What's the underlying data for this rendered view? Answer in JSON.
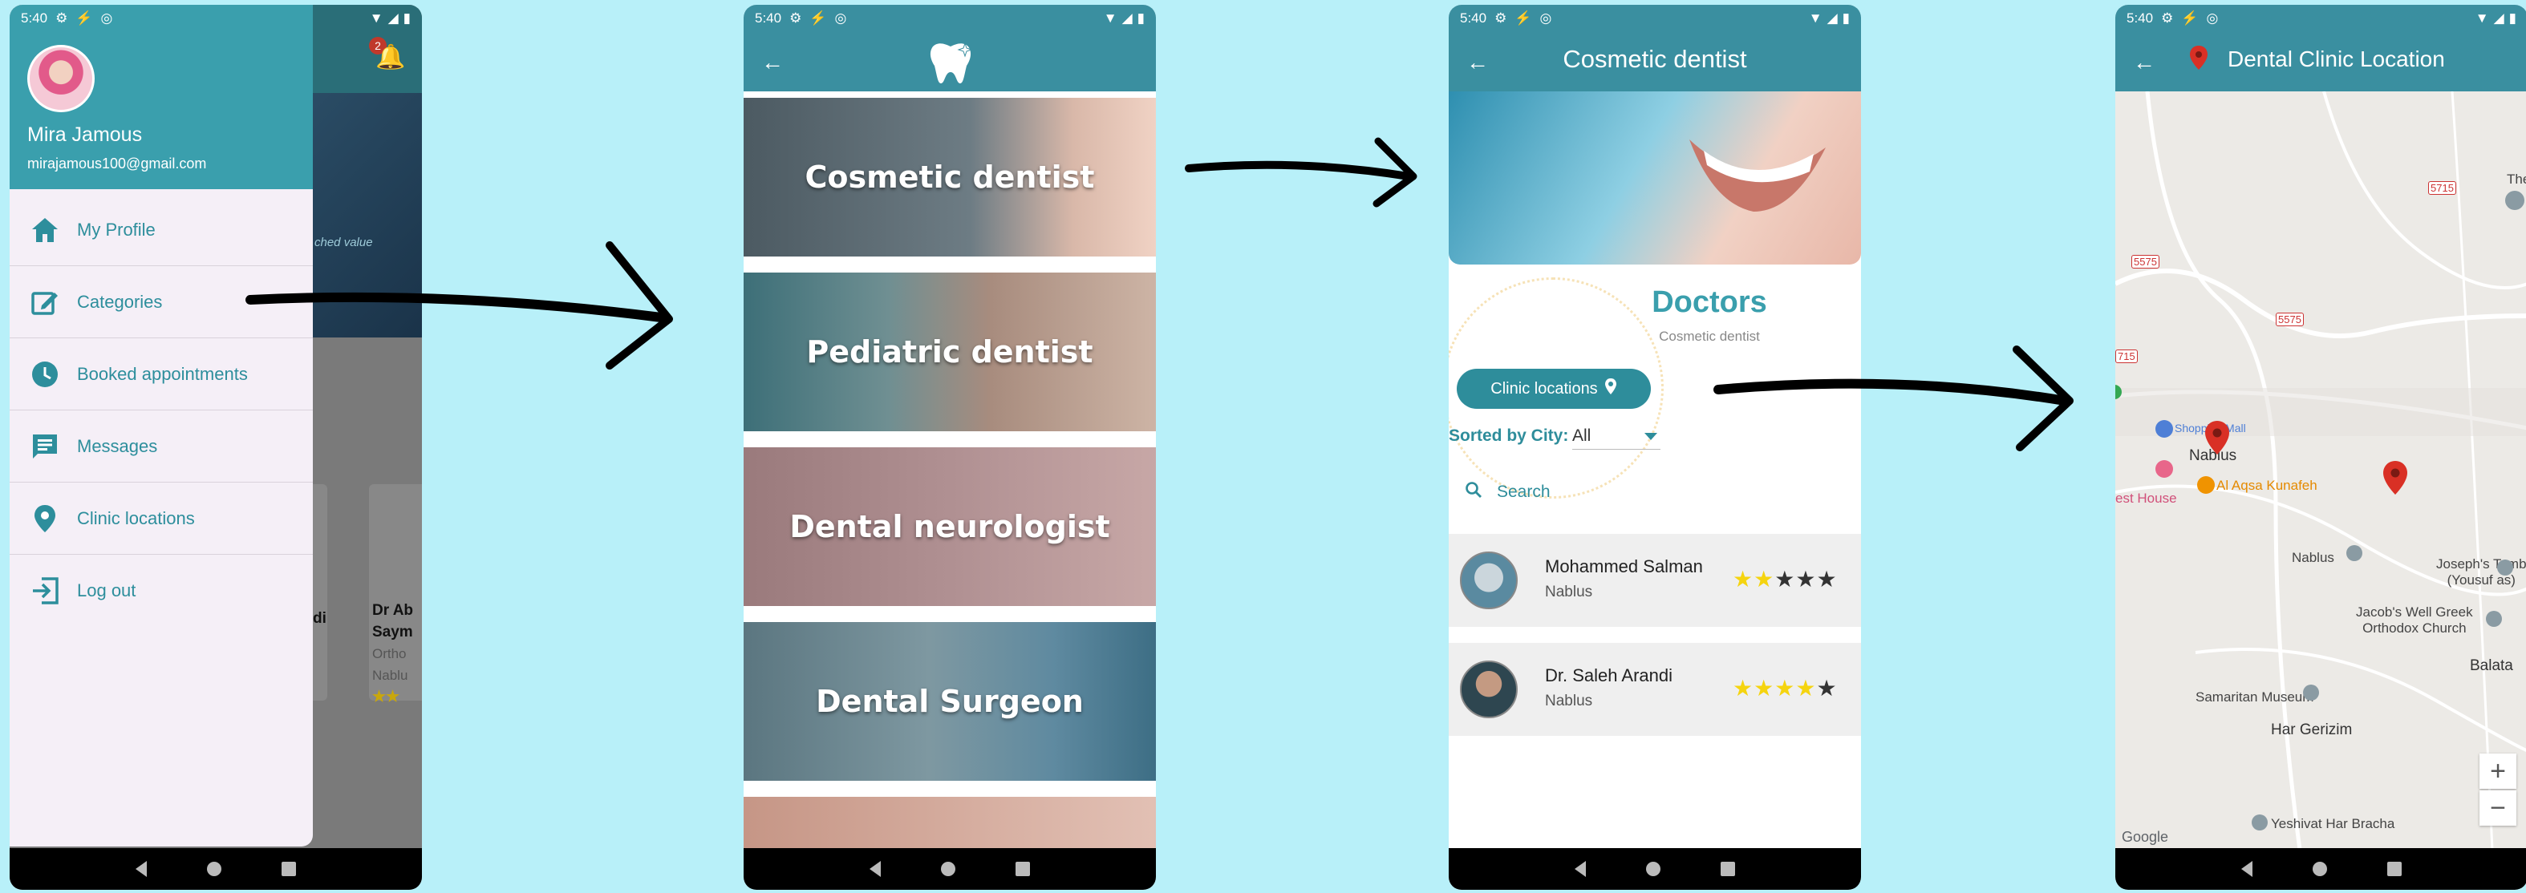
{
  "status": {
    "time": "5:40"
  },
  "drawer": {
    "user_name": "Mira Jamous",
    "user_email": "mirajamous100@gmail.com",
    "notification_count": "2",
    "menu": [
      {
        "label": "My Profile",
        "icon": "home-icon"
      },
      {
        "label": "Categories",
        "icon": "edit-icon"
      },
      {
        "label": "Booked appointments",
        "icon": "clock-icon"
      },
      {
        "label": "Messages",
        "icon": "message-icon"
      },
      {
        "label": "Clinic locations",
        "icon": "location-pin-icon"
      },
      {
        "label": "Log out",
        "icon": "logout-icon"
      }
    ],
    "background": {
      "banner_text": "ched value",
      "card1_text": "di",
      "card2_line1": "Dr Ab",
      "card2_line2": "Saym",
      "card2_line3": "Ortho",
      "card2_line4": "Nablu"
    }
  },
  "categories": {
    "items": [
      "Cosmetic dentist",
      "Pediatric dentist",
      "Dental neurologist",
      "Dental Surgeon"
    ]
  },
  "doctors_page": {
    "title": "Cosmetic dentist",
    "heading": "Doctors",
    "subheading": "Cosmetic dentist",
    "clinic_button": "Clinic locations",
    "sort_label": "Sorted by City:",
    "sort_value": "All",
    "search_placeholder": "Search",
    "doctors": [
      {
        "name": "Mohammed Salman",
        "city": "Nablus",
        "rating": 2
      },
      {
        "name": "Dr. Saleh Arandi",
        "city": "Nablus",
        "rating": 4
      }
    ]
  },
  "map_page": {
    "title": "Dental Clinic Location",
    "labels": {
      "shopping": "Shopping Mall",
      "nablus_city": "Nablus",
      "kunafeh": "Al Aqsa Kunafeh",
      "guest_house": "est House",
      "nablus": "Nablus",
      "josephs_tomb": "Joseph's Tomb\n(Yousuf as)",
      "jacobs_well": "Jacob's Well Greek\nOrthodox Church",
      "balata": "Balata",
      "samaritan": "Samaritan Museum",
      "har_gerizim": "Har Gerizim",
      "yeshivat": "Yeshivat Har Bracha",
      "the": "The",
      "google": "Google",
      "road1": "5715",
      "road2": "5575",
      "road3": "5575",
      "road4": "715"
    },
    "zoom_in": "+",
    "zoom_out": "−"
  },
  "colors": {
    "teal": "#3a9fad",
    "accent": "#2e8d9b",
    "star_on": "#f5d40f",
    "star_off": "#333333",
    "pin": "#d93025"
  }
}
